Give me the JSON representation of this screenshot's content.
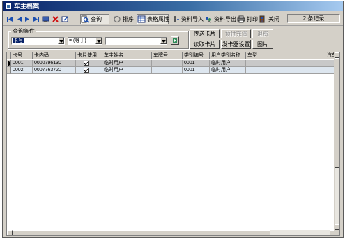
{
  "window": {
    "title": "车主档案"
  },
  "toolbar": {
    "query": "查询",
    "sort": "排序",
    "table_properties": "表格属性",
    "import": "资料导入",
    "export": "资料导出",
    "print": "打印",
    "close": "关闭",
    "record_count": "2 条记录"
  },
  "query": {
    "legend": "查询条件",
    "field": "卡号",
    "operator": "= (等于)",
    "value": ""
  },
  "buttons": {
    "send_card": "传送卡片",
    "prepaid_topup": "预付充值",
    "refund": "退费",
    "read_card": "读取卡片",
    "issuer_settings": "发卡器设置",
    "picture": "图片"
  },
  "table": {
    "columns": [
      "卡号",
      "卡内码",
      "卡片使用",
      "车主姓名",
      "车牌号",
      "类别编号",
      "用户类别名称",
      "车型",
      "汽车"
    ],
    "rows": [
      {
        "card_no": "0001",
        "inner_code": "0000796130",
        "in_use": true,
        "owner": "临时用户",
        "plate": "",
        "category_no": "0001",
        "category_name": "临时用户",
        "vehicle_type": ""
      },
      {
        "card_no": "0002",
        "inner_code": "0007763720",
        "in_use": true,
        "owner": "临时用户",
        "plate": "",
        "category_no": "0001",
        "category_name": "临时用户",
        "vehicle_type": ""
      }
    ]
  }
}
